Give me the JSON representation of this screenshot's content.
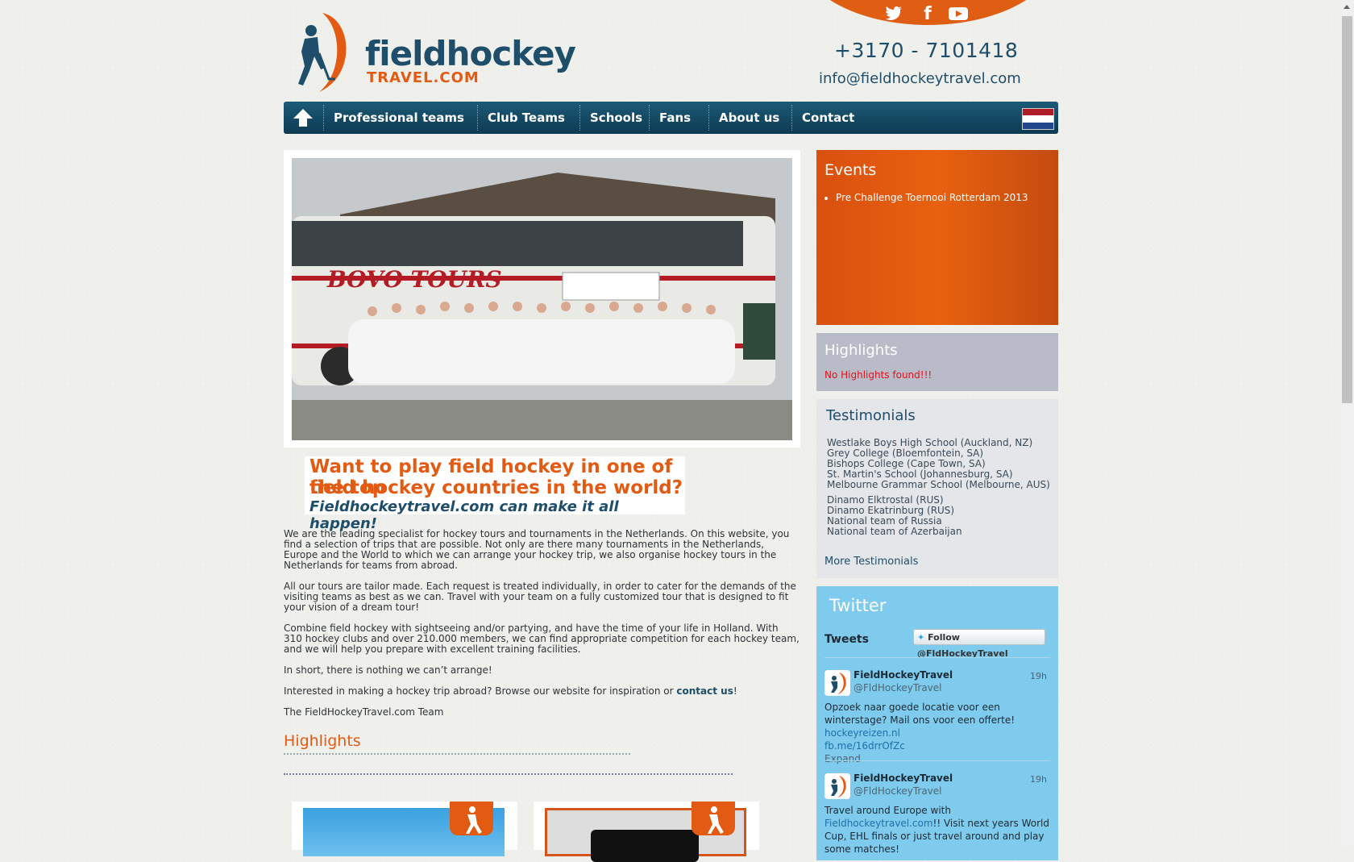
{
  "header": {
    "logo_line1": "fieldhockey",
    "logo_line2": "TRAVEL.COM",
    "phone": "+3170 - 7101418",
    "email": "info@fieldhockeytravel.com",
    "social": [
      "twitter-icon",
      "facebook-icon",
      "youtube-icon"
    ]
  },
  "nav": {
    "items": [
      {
        "label": "Professional teams"
      },
      {
        "label": "Club Teams"
      },
      {
        "label": "Schools"
      },
      {
        "label": "Fans"
      },
      {
        "label": "About us"
      },
      {
        "label": "Contact"
      }
    ]
  },
  "hero": {
    "bus_text": "BOVO TOURS",
    "tagline_1": "Want to play field hockey in one of the top",
    "tagline_2": "field hockey countries in the world?",
    "tagline_3": "Fieldhockeytravel.com can make it all happen!"
  },
  "intro": {
    "p1": "We are the leading specialist for hockey tours and tournaments in the Netherlands. On this website, you find a selection of trips that are possible. Not only are there many tournaments in the Netherlands, Europe and the World to which we can arrange your hockey trip, we also organise hockey tours in the Netherlands for teams from abroad.",
    "p2": "All our tours are tailor made. Each request is treated individually, in order to cater for the demands of the visiting teams as best as we can. Travel with your team on a fully customized tour that is designed to fit your vision of a dream tour!",
    "p3": "Combine field hockey with sightseeing and/or partying, and have the time of your life in Holland. With 310 hockey clubs and over 210.000 members, we can find appropriate competition for each hockey team, and we will help you prepare with excellent training facilities.",
    "p4": "In short, there is nothing we can’t arrange!",
    "p5_prefix": "Interested in making a hockey trip abroad? Browse our website for inspiration or ",
    "p5_link": "contact us",
    "p5_suffix": "!",
    "p6": "The FieldHockeyTravel.com Team"
  },
  "main_highlights": {
    "title": "Highlights"
  },
  "events": {
    "title": "Events",
    "items": [
      "Pre Challenge Toernooi Rotterdam 2013"
    ]
  },
  "highlights": {
    "title": "Highlights",
    "empty": "No Highlights found!!!"
  },
  "testimonials": {
    "title": "Testimonials",
    "group1": [
      "Westlake Boys High School (Auckland, NZ)",
      "Grey College (Bloemfontein, SA)",
      "Bishops College (Cape Town, SA)",
      "St. Martin's School (Johannesburg, SA)",
      "Melbourne Grammar School (Melbourne, AUS)"
    ],
    "group2": [
      "Dinamo Elktrostal (RUS)",
      "Dinamo Ekatrinburg (RUS)",
      "National team of Russia",
      "National team of Azerbaijan"
    ],
    "more": "More Testimonials"
  },
  "twitter": {
    "title": "Twitter",
    "tweets_label": "Tweets",
    "follow": "Follow @FldHockeyTravel",
    "tweets": [
      {
        "name": "FieldHockeyTravel",
        "handle": "@FldHockeyTravel",
        "time": "19h",
        "text": "Opzoek naar goede locatie voor een winterstage? Mail ons voor een offerte!",
        "link1": "hockeyreizen.nl",
        "link2": "fb.me/16drrOfZc",
        "expand": "Expand"
      },
      {
        "name": "FieldHockeyTravel",
        "handle": "@FldHockeyTravel",
        "time": "19h",
        "text_pre": "Travel around Europe with",
        "link1": "Fieldhockeytravel.com",
        "text_post": "!! Visit next years World Cup, EHL finals or just travel around and play some matches!"
      }
    ]
  },
  "colors": {
    "brand_orange": "#e35b12",
    "brand_blue": "#1f4e6b",
    "twitter_bg": "#7fcbee"
  }
}
